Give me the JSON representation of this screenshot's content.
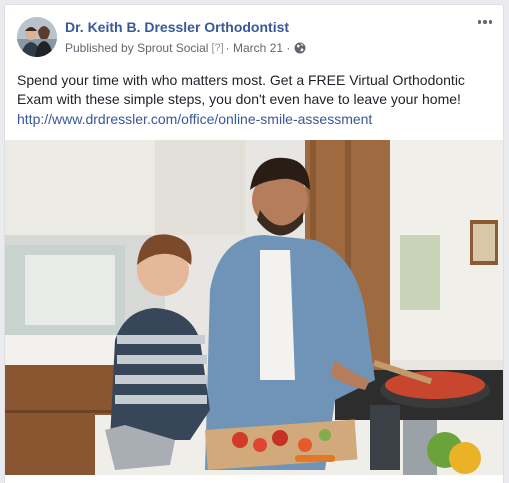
{
  "post": {
    "page_name": "Dr. Keith B. Dressler Orthodontist",
    "published_by_prefix": "Published by",
    "publisher": "Sprout Social",
    "help_mark": "[?]",
    "separator": "·",
    "date": "March 21",
    "separator2": "·",
    "privacy_icon": "globe-icon",
    "more_icon": "more-options-icon",
    "text": "Spend your time with who matters most. Get a FREE Virtual Orthodontic Exam with these simple steps, you don't even have to leave your home!",
    "link": "http://www.drdressler.com/office/online-smile-assessment"
  },
  "colors": {
    "link_blue": "#385898",
    "meta_gray": "#616770",
    "text": "#1d2129",
    "background": "#e9ebee"
  }
}
